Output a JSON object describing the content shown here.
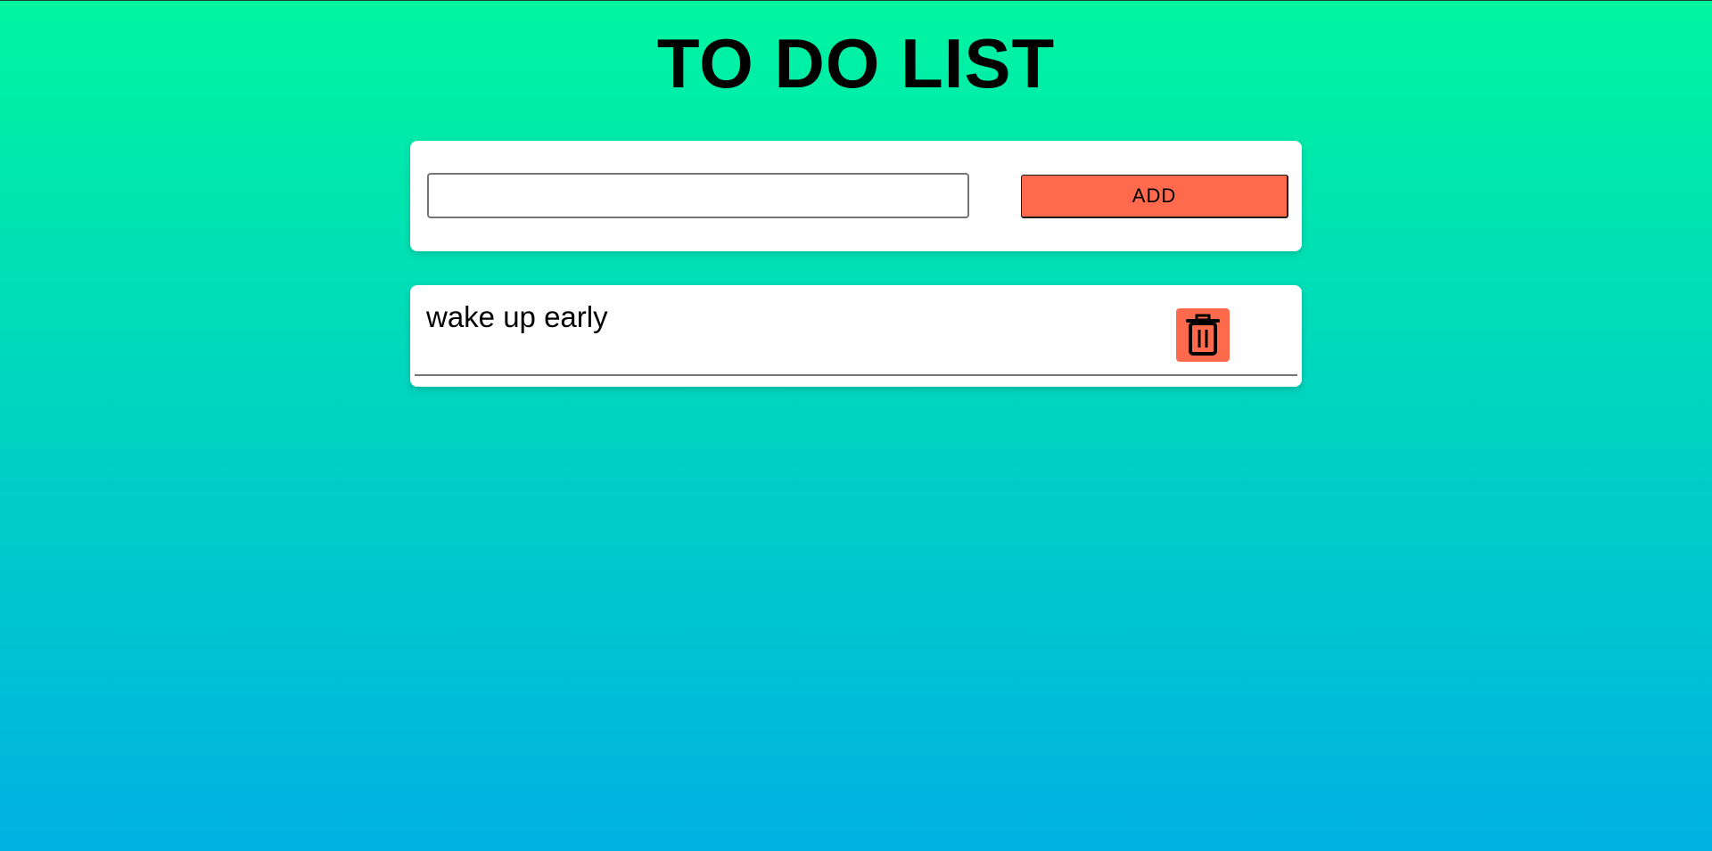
{
  "header": {
    "title": "TO DO LIST"
  },
  "form": {
    "input_value": "",
    "input_placeholder": "",
    "add_label": "ADD"
  },
  "todos": [
    {
      "text": "wake up early",
      "delete_icon": "trash-icon"
    }
  ],
  "colors": {
    "gradient_top": "#00f5a0",
    "gradient_bottom": "#00b1e3",
    "accent": "#ff6a4d"
  }
}
